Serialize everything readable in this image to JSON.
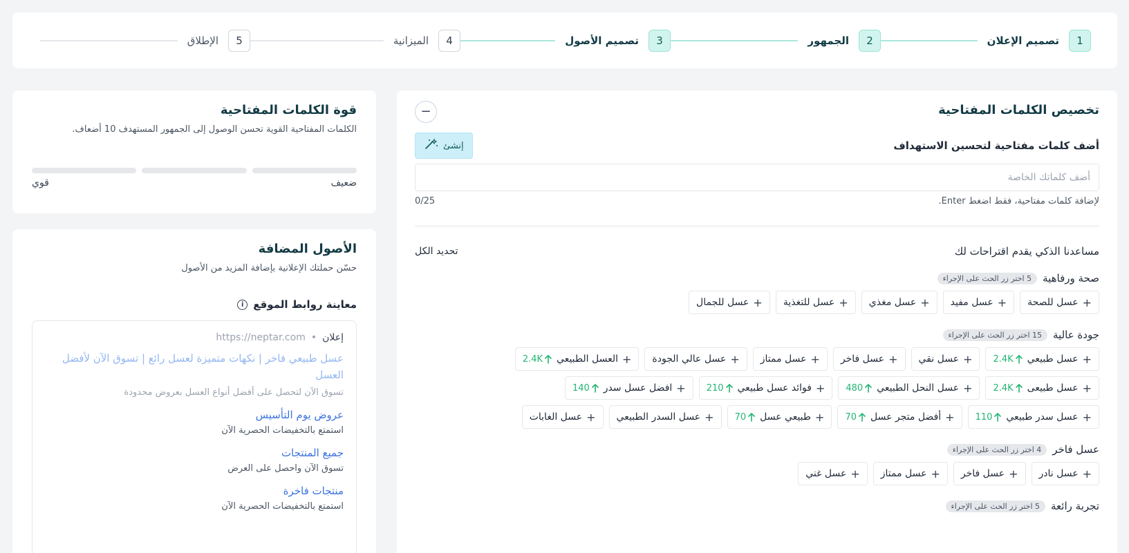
{
  "stepper": [
    {
      "num": "1",
      "label": "تصميم الإعلان",
      "active": true
    },
    {
      "num": "2",
      "label": "الجمهور",
      "active": true
    },
    {
      "num": "3",
      "label": "تصميم الأصول",
      "active": true
    },
    {
      "num": "4",
      "label": "الميزانية",
      "active": false
    },
    {
      "num": "5",
      "label": "الإطلاق",
      "active": false
    }
  ],
  "keywords": {
    "title": "تخصيص الكلمات المفتاحية",
    "collapse_symbol": "−",
    "add_label": "أضف كلمات مفتاحية لتحسين الاستهداف",
    "create_label": "إنشئ",
    "input_placeholder": "أضف كلماتك الخاصة",
    "hint": "لإضافة كلمات مفتاحية، فقط اضغط Enter.",
    "counter": "0/25",
    "suggestions_title": "مساعدنا الذكي يقدم اقتراحات لك",
    "select_all": "تحديد الكل"
  },
  "groups": [
    {
      "name": "صحة ورفاهية",
      "badge": "5 اختر زر الحث على الإجراء",
      "chips": [
        {
          "text": "عسل للصحة"
        },
        {
          "text": "عسل مفيد"
        },
        {
          "text": "عسل مغذي"
        },
        {
          "text": "عسل للتغذية"
        },
        {
          "text": "عسل للجمال"
        }
      ]
    },
    {
      "name": "جودة عالية",
      "badge": "15 اختر زر الحث على الإجراء",
      "chips": [
        {
          "text": "عسل طبيعي",
          "trend": "2.4K"
        },
        {
          "text": "عسل نقي"
        },
        {
          "text": "عسل فاخر"
        },
        {
          "text": "عسل ممتاز"
        },
        {
          "text": "عسل عالي الجودة"
        },
        {
          "text": "العسل الطبيعي",
          "trend": "2.4K"
        },
        {
          "text": "عسل طبيعى",
          "trend": "2.4K"
        },
        {
          "text": "عسل النحل الطبيعي",
          "trend": "480"
        },
        {
          "text": "فوائد عسل طبيعي",
          "trend": "210"
        },
        {
          "text": "افضل عسل سدر",
          "trend": "140"
        },
        {
          "text": "عسل سدر طبيعي",
          "trend": "110"
        },
        {
          "text": "أفضل متجر عسل",
          "trend": "70"
        },
        {
          "text": "طبيعي عسل",
          "trend": "70"
        },
        {
          "text": "عسل السدر الطبيعي"
        },
        {
          "text": "عسل الغابات"
        }
      ]
    },
    {
      "name": "عسل فاخر",
      "badge": "4 اختر زر الحث على الإجراء",
      "chips": [
        {
          "text": "عسل نادر"
        },
        {
          "text": "عسل فاخر"
        },
        {
          "text": "عسل ممتاز"
        },
        {
          "text": "عسل غني"
        }
      ]
    },
    {
      "name": "تجربة رائعة",
      "badge": "5 اختر زر الحث على الإجراء",
      "chips": []
    }
  ],
  "strength": {
    "title": "قوة الكلمات المفتاحية",
    "subtitle": "الكلمات المفتاحية القوية تحسن الوصول إلى الجمهور المستهدف 10 أضعاف.",
    "weak": "ضعيف",
    "strong": "قوي"
  },
  "assets": {
    "title": "الأصول المضافة",
    "subtitle": "حسّن حملتك الإعلانية بإضافة المزيد من الأصول",
    "preview_title": "معاينة روابط الموقع",
    "ad_tag": "إعلان",
    "ad_url": "https://neptar.com",
    "ad_headline": "عسل طبيعي فاخر  |  نكهات متميزة لعسل رائع  |  تسوق الآن لأفضل العسل",
    "ad_desc": "تسوق الآن لتحصل على أفضل أنواع العسل بعروض محدودة",
    "sitelinks": [
      {
        "title": "عروض يوم التأسيس",
        "desc": "استمتع بالتخفيضات الحصرية الآن"
      },
      {
        "title": "جميع المنتجات",
        "desc": "تسوق الآن واحصل على العرض"
      },
      {
        "title": "منتجات فاخرة",
        "desc": "استمتع بالتخفيضات الحصرية الآن"
      }
    ]
  }
}
